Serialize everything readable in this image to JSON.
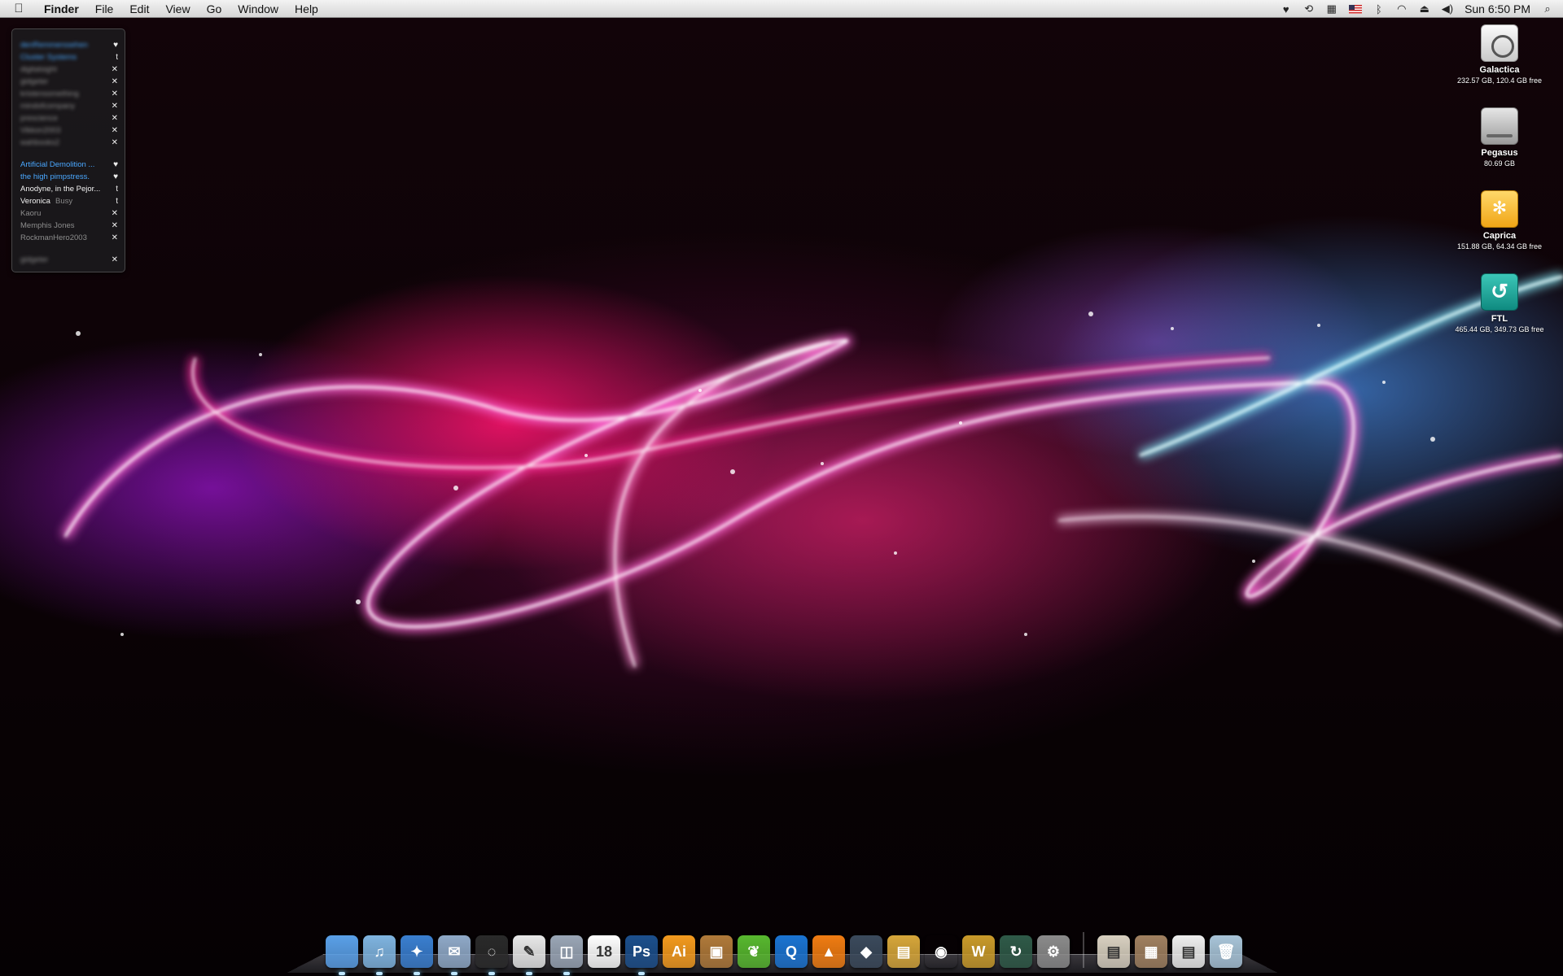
{
  "menubar": {
    "app_name": "Finder",
    "menus": [
      "File",
      "Edit",
      "View",
      "Go",
      "Window",
      "Help"
    ],
    "clock": "Sun 6:50 PM",
    "status_icons": [
      "heart-icon",
      "time-machine-icon",
      "input-menu-icon",
      "flag-icon",
      "bluetooth-icon",
      "wifi-icon",
      "eject-icon",
      "volume-icon",
      "spotlight-icon"
    ]
  },
  "buddies": {
    "group1": [
      {
        "name": "denRemmerssehen",
        "icon": "♥",
        "color": "#4aa8ff",
        "blurred": true
      },
      {
        "name": "Cluster Systems",
        "icon": "t",
        "color": "#4aa8ff",
        "blurred": true
      },
      {
        "name": "digitalsight",
        "icon": "✕",
        "color": "#8d8d8d",
        "blurred": true
      },
      {
        "name": "gidgeter",
        "icon": "✕",
        "color": "#8d8d8d",
        "blurred": true
      },
      {
        "name": "kristensomething",
        "icon": "✕",
        "color": "#8d8d8d",
        "blurred": true
      },
      {
        "name": "mindofcompany",
        "icon": "✕",
        "color": "#8d8d8d",
        "blurred": true
      },
      {
        "name": "prescience",
        "icon": "✕",
        "color": "#8d8d8d",
        "blurred": true
      },
      {
        "name": "Vikkon2003",
        "icon": "✕",
        "color": "#8d8d8d",
        "blurred": true
      },
      {
        "name": "wahbooks2",
        "icon": "✕",
        "color": "#8d8d8d",
        "blurred": true
      }
    ],
    "group2": [
      {
        "name": "Artificial Demolition ...",
        "icon": "♥",
        "color": "#4aa8ff"
      },
      {
        "name": "the high pimpstress.",
        "icon": "♥",
        "color": "#4aa8ff"
      },
      {
        "name": "Anodyne, in the Pejor...",
        "icon": "t",
        "color": "#f2f2f2"
      },
      {
        "name": "Veronica",
        "status": "Busy",
        "icon": "t",
        "color": "#f2f2f2"
      },
      {
        "name": "Kaoru",
        "icon": "✕",
        "color": "#8d8d8d"
      },
      {
        "name": "Memphis Jones",
        "icon": "✕",
        "color": "#8d8d8d"
      },
      {
        "name": "RockmanHero2003",
        "icon": "✕",
        "color": "#8d8d8d"
      }
    ],
    "group3": [
      {
        "name": "gidgeter",
        "icon": "✕",
        "color": "#8d8d8d",
        "blurred": true
      }
    ]
  },
  "drives": [
    {
      "name": "Galactica",
      "info": "232.57 GB, 120.4 GB free",
      "icon": "internal-hd-icon"
    },
    {
      "name": "Pegasus",
      "info": "80.69 GB",
      "icon": "external-hd-icon"
    },
    {
      "name": "Caprica",
      "info": "151.88 GB, 64.34 GB free",
      "icon": "firewire-drive-icon"
    },
    {
      "name": "FTL",
      "info": "465.44 GB, 349.73 GB free",
      "icon": "time-machine-drive-icon"
    }
  ],
  "dock": {
    "apps": [
      {
        "name": "finder-icon",
        "label": "",
        "bg": "#5aa0e8",
        "running": true
      },
      {
        "name": "itunes-icon",
        "label": "♫",
        "bg": "#7fb4e0",
        "running": true
      },
      {
        "name": "safari-icon",
        "label": "✦",
        "bg": "#3a7fd0",
        "running": true
      },
      {
        "name": "mail-icon",
        "label": "✉",
        "bg": "#8fa9c8",
        "running": true
      },
      {
        "name": "adium-icon",
        "label": "◌",
        "bg": "#2a2a2a",
        "running": true
      },
      {
        "name": "textedit-icon",
        "label": "✎",
        "bg": "#e8e8e8",
        "running": true
      },
      {
        "name": "preview-icon",
        "label": "◫",
        "bg": "#9aa6b6",
        "running": true
      },
      {
        "name": "ical-icon",
        "label": "18",
        "bg": "#ffffff",
        "running": false
      },
      {
        "name": "photoshop-icon",
        "label": "Ps",
        "bg": "#1c4f8c",
        "running": true
      },
      {
        "name": "illustrator-icon",
        "label": "Ai",
        "bg": "#f39a1e",
        "running": false
      },
      {
        "name": "iphoto-icon",
        "label": "▣",
        "bg": "#b07a3a",
        "running": false
      },
      {
        "name": "leaf-icon",
        "label": "❦",
        "bg": "#58b82f",
        "running": false
      },
      {
        "name": "quicktime-icon",
        "label": "Q",
        "bg": "#1b74d2",
        "running": false
      },
      {
        "name": "vlc-icon",
        "label": "▲",
        "bg": "#f07c12",
        "running": false
      },
      {
        "name": "utility-icon",
        "label": "◆",
        "bg": "#3b4a5c",
        "running": false
      },
      {
        "name": "transmit-icon",
        "label": "▤",
        "bg": "#d6a63a",
        "running": false
      },
      {
        "name": "ical-red-icon",
        "label": "◉",
        "bg": "#d33",
        "running": false
      },
      {
        "name": "warcraft-icon",
        "label": "W",
        "bg": "#c99a2a",
        "running": false
      },
      {
        "name": "time-machine-icon",
        "label": "↻",
        "bg": "#2f5a48",
        "running": false
      },
      {
        "name": "system-preferences-icon",
        "label": "⚙",
        "bg": "#8b8b8b",
        "running": false
      }
    ],
    "stacks": [
      {
        "name": "documents-stack-icon",
        "label": "▤",
        "bg": "#d8d0c0"
      },
      {
        "name": "pictures-stack-icon",
        "label": "▦",
        "bg": "#a08060"
      },
      {
        "name": "downloads-stack-icon",
        "label": "▤",
        "bg": "#eeeeee"
      },
      {
        "name": "trash-icon",
        "label": "🗑",
        "bg": "#a8c4d8"
      }
    ]
  }
}
